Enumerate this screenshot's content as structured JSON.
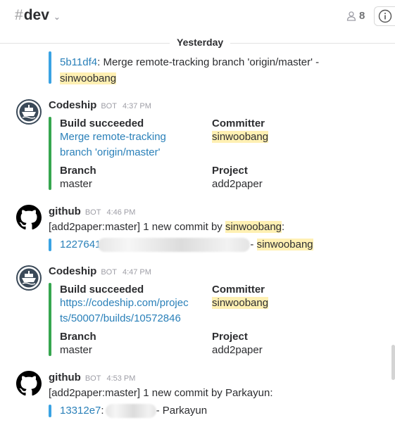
{
  "header": {
    "hash": "#",
    "channel_name": "dev",
    "member_count": "8"
  },
  "day_divider": "Yesterday",
  "partial_message": {
    "commit_hash": "5b11df4",
    "commit_text": ": Merge remote-tracking branch 'origin/master' -",
    "author": "sinwoobang"
  },
  "messages": [
    {
      "sender": "Codeship",
      "bot": "BOT",
      "time": "4:37 PM",
      "build_title": "Build succeeded",
      "link_line1": "Merge remote-tracking",
      "link_line2": "branch 'origin/master'",
      "committer_title": "Committer",
      "committer": "sinwoobang",
      "branch_title": "Branch",
      "branch": "master",
      "project_title": "Project",
      "project": "add2paper"
    },
    {
      "sender": "github",
      "bot": "BOT",
      "time": "4:46 PM",
      "text": "[add2paper:master] 1 new commit by ",
      "author": "sinwoobang",
      "colon": ":",
      "commit_hash": "1227641",
      "dash": "- ",
      "commit_author": "sinwoobang"
    },
    {
      "sender": "Codeship",
      "bot": "BOT",
      "time": "4:47 PM",
      "build_title": "Build succeeded",
      "link_line1": "https://codeship.com/projec",
      "link_line2": "ts/50007/builds/10572846",
      "committer_title": "Committer",
      "committer": "sinwoobang",
      "branch_title": "Branch",
      "branch": "master",
      "project_title": "Project",
      "project": "add2paper"
    },
    {
      "sender": "github",
      "bot": "BOT",
      "time": "4:53 PM",
      "text": "[add2paper:master] 1 new commit by Parkayun:",
      "commit_hash": "13312e7",
      "colon": ":",
      "dash": "- Parkayun"
    }
  ],
  "colors": {
    "link": "#2a80b9",
    "highlight": "#fff0b3",
    "attachment_success": "#36a64f",
    "attachment_commit": "#3aa3e3"
  }
}
